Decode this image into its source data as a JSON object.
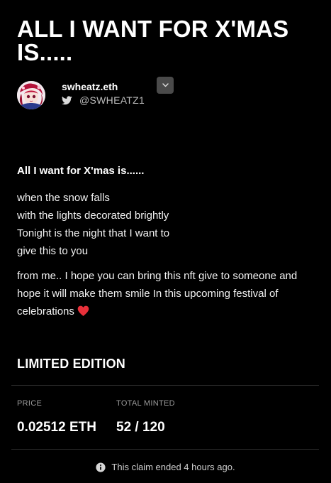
{
  "drop": {
    "title": "ALL I WANT FOR X'MAS IS....."
  },
  "author": {
    "name": "swheatz.eth",
    "handle": "@SWHEATZ1",
    "avatar_icon": "anime-character-avatar",
    "social_icon": "twitter-icon"
  },
  "menu": {
    "toggle_icon": "chevron-down-icon"
  },
  "description": {
    "heading": "All I want for X'mas is......",
    "poem_lines": [
      "when the snow falls",
      "with the lights decorated brightly",
      "Tonight is the night that I want to",
      "give this to you"
    ],
    "message": "from me.. I hope you can bring this nft give to someone and hope it will make them smile In this upcoming festival of celebrations",
    "emoji_icon": "red-heart-icon"
  },
  "edition": {
    "label": "LIMITED EDITION",
    "price_label": "PRICE",
    "price_value": "0.02512 ETH",
    "minted_label": "TOTAL MINTED",
    "minted_value": "52 / 120"
  },
  "claim": {
    "status": "This claim ended 4 hours ago.",
    "icon": "info-icon"
  },
  "colors": {
    "background": "#000000",
    "text": "#ffffff",
    "muted": "#9a9a9a",
    "heart": "#e8303a",
    "twitter_icon": "#d9d9d9"
  }
}
